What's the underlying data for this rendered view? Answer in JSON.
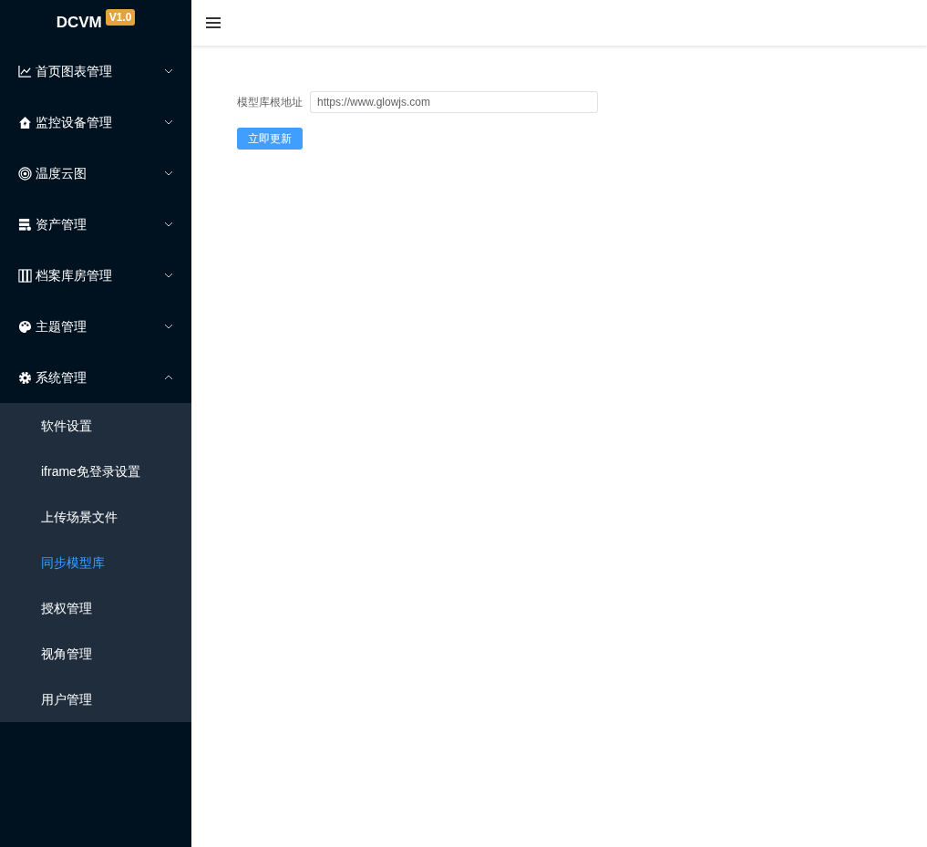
{
  "sidebar": {
    "logo": "DCVM",
    "version": "V1.0",
    "items": [
      {
        "label": "首页图表管理",
        "expanded": false
      },
      {
        "label": "监控设备管理",
        "expanded": false
      },
      {
        "label": "温度云图",
        "expanded": false
      },
      {
        "label": "资产管理",
        "expanded": false
      },
      {
        "label": "档案库房管理",
        "expanded": false
      },
      {
        "label": "主题管理",
        "expanded": false
      },
      {
        "label": "系统管理",
        "expanded": true,
        "children": [
          {
            "label": "软件设置",
            "selected": false
          },
          {
            "label": "iframe免登录设置",
            "selected": false
          },
          {
            "label": "上传场景文件",
            "selected": false
          },
          {
            "label": "同步模型库",
            "selected": true
          },
          {
            "label": "授权管理",
            "selected": false
          },
          {
            "label": "视角管理",
            "selected": false
          },
          {
            "label": "用户管理",
            "selected": false
          }
        ]
      }
    ]
  },
  "form": {
    "label": "模型库根地址",
    "value": "https://www.glowjs.com",
    "button": "立即更新"
  }
}
